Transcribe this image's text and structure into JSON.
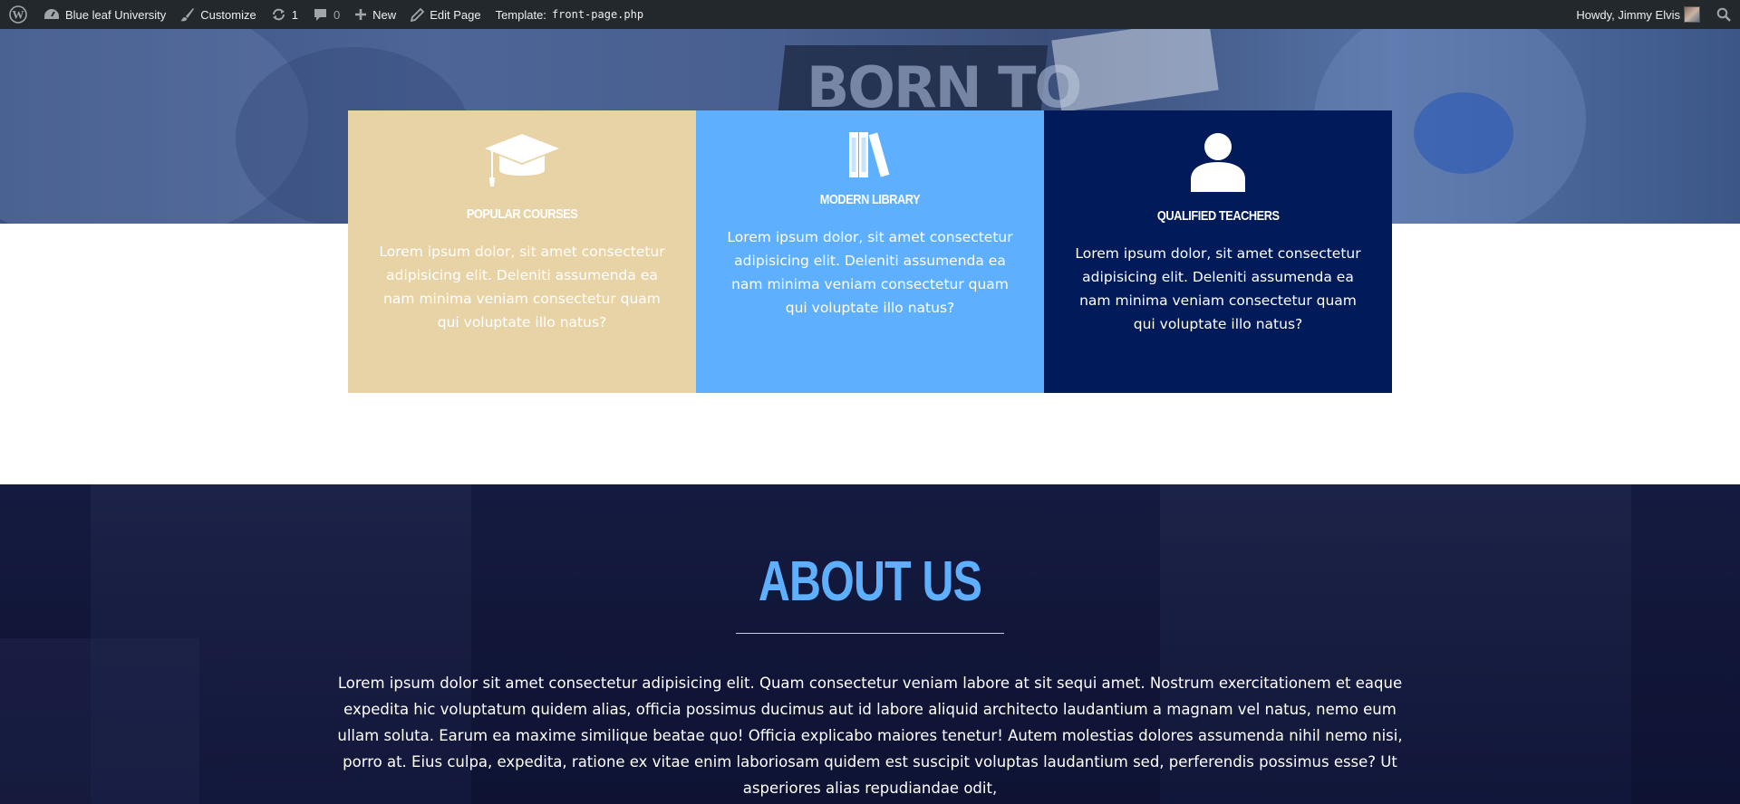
{
  "adminbar": {
    "site_name": "Blue leaf University",
    "customize": "Customize",
    "updates_count": "1",
    "comments_count": "0",
    "new_label": "New",
    "edit_page": "Edit Page",
    "template_label": "Template:",
    "template_file": "front-page.php",
    "howdy": "Howdy, Jimmy Elvis"
  },
  "hero": {
    "book_text": "BORN TO"
  },
  "features": [
    {
      "title": "Popular Courses",
      "text": "Lorem ipsum dolor, sit amet consectetur adipisicing elit. Deleniti assumenda ea nam minima veniam consectetur quam qui voluptate illo natus?",
      "icon": "graduation-cap-icon",
      "bg": "#e8d3a6"
    },
    {
      "title": "Modern Library",
      "text": "Lorem ipsum dolor, sit amet consectetur adipisicing elit. Deleniti assumenda ea nam minima veniam consectetur quam qui voluptate illo natus?",
      "icon": "books-icon",
      "bg": "#5eb0fe"
    },
    {
      "title": "Qualified Teachers",
      "text": "Lorem ipsum dolor, sit amet consectetur adipisicing elit. Deleniti assumenda ea nam minima veniam consectetur quam qui voluptate illo natus?",
      "icon": "person-icon",
      "bg": "#001a5a"
    }
  ],
  "about": {
    "title": "ABOUT US",
    "text": "Lorem ipsum dolor sit amet consectetur adipisicing elit. Quam consectetur veniam labore at sit sequi amet. Nostrum exercitationem et eaque expedita hic voluptatum quidem alias, officia possimus ducimus aut id labore aliquid architecto laudantium a magnam vel natus, nemo eum ullam soluta. Earum ea maxime similique beatae quo! Officia explicabo maiores tenetur! Autem molestias dolores assumenda nihil nemo nisi, porro at. Eius culpa, expedita, ratione ex vitae enim laboriosam quidem est suscipit voluptas laudantium sed, perferendis possimus esse? Ut asperiores alias repudiandae odit,",
    "title_color": "#5eb0fe"
  }
}
